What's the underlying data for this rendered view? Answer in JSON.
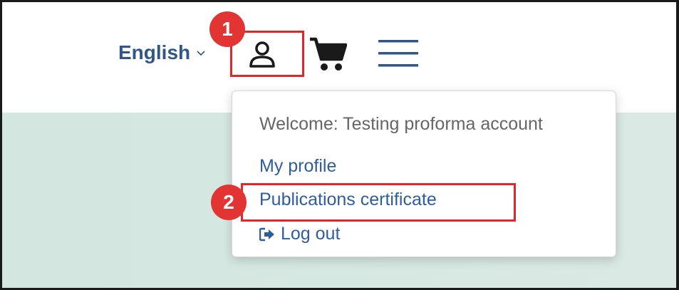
{
  "header": {
    "language_label": "English"
  },
  "annotations": {
    "step1": "1",
    "step2": "2",
    "highlight_color": "#e3262a",
    "badge_color": "#e23533"
  },
  "dropdown": {
    "welcome_text": "Welcome: Testing proforma account",
    "items": [
      {
        "label": "My profile"
      },
      {
        "label": "Publications certificate"
      },
      {
        "label": "Log out",
        "icon": "logout-icon"
      }
    ]
  },
  "colors": {
    "link": "#2f5e9a",
    "language": "#2f5787",
    "content_bg": "#d3e6e0"
  },
  "icons": [
    "chevron-down-icon",
    "user-icon",
    "cart-icon",
    "hamburger-menu-icon",
    "logout-icon"
  ]
}
